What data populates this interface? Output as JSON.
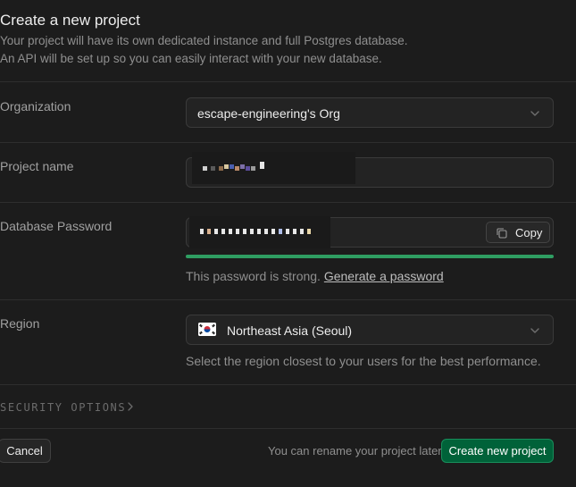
{
  "header": {
    "title": "Create a new project",
    "subtitle_line1": "Your project will have its own dedicated instance and full Postgres database.",
    "subtitle_line2": "An API will be set up so you can easily interact with your new database."
  },
  "organization": {
    "label": "Organization",
    "value": "escape-engineering's Org"
  },
  "project_name": {
    "label": "Project name",
    "value": ""
  },
  "database_password": {
    "label": "Database Password",
    "value": "",
    "copy_label": "Copy",
    "strength_text": "This password is strong.",
    "generate_link": "Generate a password",
    "strength_color": "#2f9e62"
  },
  "region": {
    "label": "Region",
    "value": "Northeast Asia (Seoul)",
    "flag_icon": "south-korea-flag-icon",
    "helper": "Select the region closest to your users for the best performance."
  },
  "security": {
    "label": "SECURITY OPTIONS"
  },
  "footer": {
    "cancel_label": "Cancel",
    "rename_note": "You can rename your project later",
    "create_label": "Create new project",
    "accent": "#006239"
  }
}
